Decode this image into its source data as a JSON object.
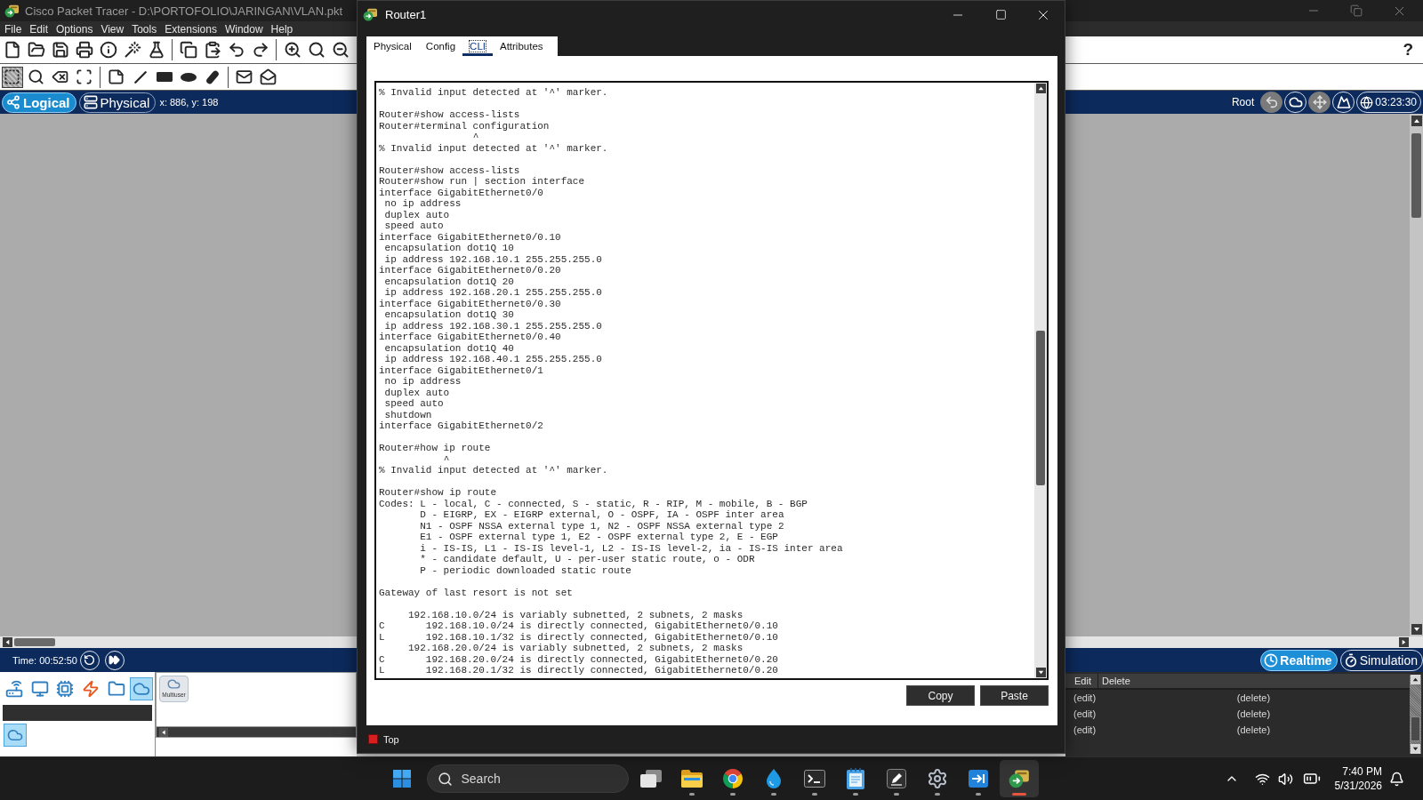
{
  "app": {
    "title": "Cisco Packet Tracer - D:\\PORTOFOLIO\\JARINGAN\\VLAN.pkt",
    "menu": [
      "File",
      "Edit",
      "Options",
      "View",
      "Tools",
      "Extensions",
      "Window",
      "Help"
    ],
    "help": "?"
  },
  "toolbar_tools": [
    [
      {
        "kind": "select",
        "selected": true
      },
      {
        "kind": "inspect",
        "selected": false
      },
      {
        "kind": "delete",
        "selected": false
      },
      {
        "kind": "resize",
        "selected": false
      }
    ],
    [
      {
        "kind": "note",
        "selected": false
      },
      {
        "kind": "line",
        "selected": false
      },
      {
        "kind": "rectangle",
        "selected": false
      },
      {
        "kind": "ellipse",
        "selected": false
      },
      {
        "kind": "freeform",
        "selected": false
      }
    ],
    [
      {
        "kind": "simplepdu",
        "selected": false
      },
      {
        "kind": "complexpdu",
        "selected": false
      }
    ]
  ],
  "mode_bar": {
    "views": [
      {
        "kind": "logical",
        "label": "Logical",
        "selected": true
      },
      {
        "kind": "physical",
        "label": "Physical",
        "selected": false
      }
    ],
    "coordinates": "x: 886, y: 198",
    "root": "Root",
    "tools": [
      {
        "kind": "back",
        "disabled": true
      },
      {
        "kind": "cluster",
        "disabled": false
      },
      {
        "kind": "move",
        "disabled": true
      },
      {
        "kind": "background",
        "disabled": false
      }
    ],
    "clock": "03:23:30"
  },
  "time_bar": {
    "time": "Time: 00:52:50",
    "modes": [
      {
        "kind": "realtime",
        "label": "Realtime",
        "selected": true
      },
      {
        "kind": "simulation",
        "label": "Simulation",
        "selected": false
      }
    ]
  },
  "device_panel": {
    "categories": [
      {
        "kind": "network",
        "selected": false
      },
      {
        "kind": "enddevices",
        "selected": false
      },
      {
        "kind": "components",
        "selected": false
      },
      {
        "kind": "connections",
        "selected": false
      },
      {
        "kind": "misc",
        "selected": false
      },
      {
        "kind": "multiuser",
        "selected": true
      }
    ],
    "subcategories": [
      {
        "kind": "multiuser",
        "selected": true
      }
    ],
    "devices": [
      {
        "label": "Multiuser"
      }
    ]
  },
  "event_list": {
    "columns": [
      "Edit",
      "Delete"
    ],
    "rows": [
      [
        "(edit)",
        "(delete)"
      ],
      [
        "(edit)",
        "(delete)"
      ],
      [
        "(edit)",
        "(delete)"
      ]
    ]
  },
  "router_window": {
    "title": "Router1",
    "tabs": [
      {
        "label": "Physical",
        "selected": false
      },
      {
        "label": "Config",
        "selected": false
      },
      {
        "label": "CLI",
        "selected": true
      },
      {
        "label": "Attributes",
        "selected": false
      }
    ],
    "cli": {
      "blocks": [
        [
          "% Invalid input detected at '^' marker."
        ],
        [
          "Router#show access-lists",
          "Router#terminal configuration",
          "                ^",
          "% Invalid input detected at '^' marker."
        ],
        [
          "Router#show access-lists",
          "Router#show run | section interface",
          "interface GigabitEthernet0/0",
          " no ip address",
          " duplex auto",
          " speed auto",
          "interface GigabitEthernet0/0.10",
          " encapsulation dot1Q 10",
          " ip address 192.168.10.1 255.255.255.0",
          "interface GigabitEthernet0/0.20",
          " encapsulation dot1Q 20",
          " ip address 192.168.20.1 255.255.255.0",
          "interface GigabitEthernet0/0.30",
          " encapsulation dot1Q 30",
          " ip address 192.168.30.1 255.255.255.0",
          "interface GigabitEthernet0/0.40",
          " encapsulation dot1Q 40",
          " ip address 192.168.40.1 255.255.255.0",
          "interface GigabitEthernet0/1",
          " no ip address",
          " duplex auto",
          " speed auto",
          " shutdown",
          "interface GigabitEthernet0/2"
        ],
        [
          "Router#how ip route",
          "           ^",
          "% Invalid input detected at '^' marker."
        ],
        [
          "Router#show ip route",
          "Codes: L - local, C - connected, S - static, R - RIP, M - mobile, B - BGP",
          "       D - EIGRP, EX - EIGRP external, O - OSPF, IA - OSPF inter area",
          "       N1 - OSPF NSSA external type 1, N2 - OSPF NSSA external type 2",
          "       E1 - OSPF external type 1, E2 - OSPF external type 2, E - EGP",
          "       i - IS-IS, L1 - IS-IS level-1, L2 - IS-IS level-2, ia - IS-IS inter area",
          "       * - candidate default, U - per-user static route, o - ODR",
          "       P - periodic downloaded static route"
        ],
        [
          "Gateway of last resort is not set"
        ],
        [
          "     192.168.10.0/24 is variably subnetted, 2 subnets, 2 masks",
          "C       192.168.10.0/24 is directly connected, GigabitEthernet0/0.10",
          "L       192.168.10.1/32 is directly connected, GigabitEthernet0/0.10",
          "     192.168.20.0/24 is variably subnetted, 2 subnets, 2 masks",
          "C       192.168.20.0/24 is directly connected, GigabitEthernet0/0.20",
          "L       192.168.20.1/32 is directly connected, GigabitEthernet0/0.20"
        ]
      ]
    },
    "buttons": [
      "Copy",
      "Paste"
    ],
    "top": {
      "label": "Top",
      "checked": false
    }
  },
  "taskbar": {
    "search": {
      "placeholder": "Search"
    },
    "apps": [
      {
        "kind": "taskview",
        "running": false,
        "selected": false
      },
      {
        "kind": "files",
        "running": true,
        "selected": false
      },
      {
        "kind": "browser",
        "running": true,
        "selected": false
      },
      {
        "kind": "droplet",
        "running": true,
        "selected": false
      },
      {
        "kind": "terminal",
        "running": true,
        "selected": false
      },
      {
        "kind": "notepad",
        "running": true,
        "selected": false
      },
      {
        "kind": "pen",
        "running": true,
        "selected": false
      },
      {
        "kind": "settings",
        "running": true,
        "selected": false
      },
      {
        "kind": "arrowbox",
        "running": true,
        "selected": false
      },
      {
        "kind": "packettracer",
        "running": true,
        "selected": true
      }
    ],
    "time": "7:40 PM",
    "date": "5/31/2026"
  }
}
